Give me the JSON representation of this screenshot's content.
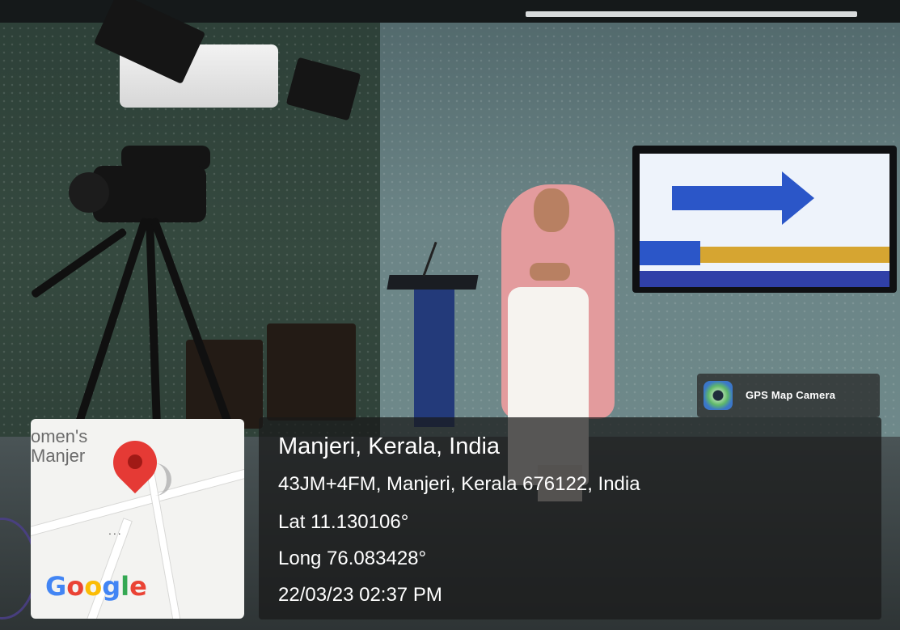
{
  "watermark": {
    "app_name": "GPS Map Camera",
    "app_icon": "gps-map-camera-icon"
  },
  "location": {
    "place": "Manjeri, Kerala, India",
    "address": "43JM+4FM, Manjeri, Kerala 676122, India",
    "latitude": "Lat 11.130106°",
    "longitude": "Long 76.083428°",
    "datetime": "22/03/23 02:37 PM"
  },
  "map": {
    "label": "omen's\nManjer",
    "provider": "Google",
    "dots": "...",
    "pin_icon": "map-pin-icon"
  },
  "colors": {
    "pin": "#e53a35",
    "overlay": "rgba(25,25,25,0.72)",
    "text": "#ffffff"
  }
}
